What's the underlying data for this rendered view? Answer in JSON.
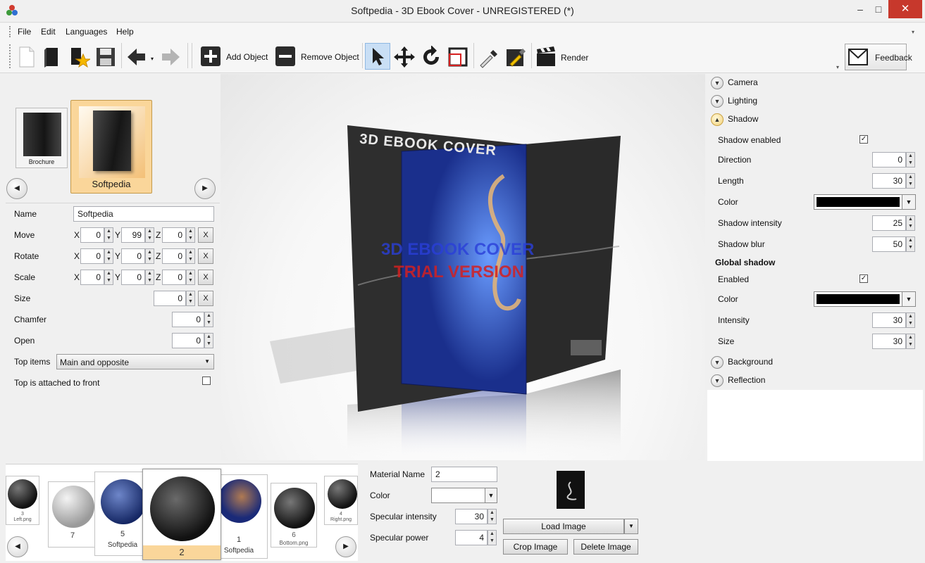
{
  "window": {
    "title": "Softpedia - 3D Ebook Cover - UNREGISTERED (*)",
    "minimize": "–",
    "maximize": "□",
    "close": "✕"
  },
  "menu": [
    "File",
    "Edit",
    "Languages",
    "Help"
  ],
  "toolbar": {
    "add_object": "Add Object",
    "remove_object": "Remove Object",
    "render": "Render",
    "feedback": "Feedback",
    "icons": [
      "new-page-icon",
      "book-icon",
      "favorite-star-icon",
      "save-icon",
      "back-arrow-icon",
      "forward-arrow-icon",
      "add-icon",
      "remove-icon",
      "select-pointer-icon",
      "move-arrows-icon",
      "rotate-icon",
      "crop-frame-icon",
      "eyedropper-icon",
      "color-picker-icon",
      "clapperboard-icon",
      "envelope-icon"
    ]
  },
  "templates": {
    "items": [
      {
        "label": "Brochure"
      },
      {
        "label": "Softpedia",
        "selected": true
      }
    ],
    "prev": "◀",
    "next": "▶"
  },
  "props": {
    "name_label": "Name",
    "name_value": "Softpedia",
    "move_label": "Move",
    "move": {
      "x": "0",
      "y": "99",
      "z": "0"
    },
    "rotate_label": "Rotate",
    "rotate": {
      "x": "0",
      "y": "0",
      "z": "0"
    },
    "scale_label": "Scale",
    "scale": {
      "x": "0",
      "y": "0",
      "z": "0"
    },
    "axis_x": "X",
    "axis_y": "Y",
    "axis_z": "Z",
    "reset": "X",
    "size_label": "Size",
    "size_value": "0",
    "chamfer_label": "Chamfer",
    "chamfer_value": "0",
    "open_label": "Open",
    "open_value": "0",
    "top_items_label": "Top items",
    "top_items_value": "Main and opposite",
    "top_attached_label": "Top is attached to front",
    "top_attached_checked": false
  },
  "viewport": {
    "cover_title": "3D EBOOK COVER",
    "watermark_line1": "3D EBOOK COVER",
    "watermark_line2": "TRIAL VERSION",
    "colors": {
      "cover_blue": "#1a2f8c",
      "back_panel": "#2e2e2e",
      "watermark_blue": "#2a3fd9",
      "watermark_red": "#d42020"
    }
  },
  "right": {
    "sections": {
      "camera": "Camera",
      "lighting": "Lighting",
      "shadow": "Shadow",
      "background": "Background",
      "reflection": "Reflection"
    },
    "shadow": {
      "enabled_label": "Shadow enabled",
      "enabled": true,
      "direction_label": "Direction",
      "direction": "0",
      "length_label": "Length",
      "length": "30",
      "color_label": "Color",
      "color": "#000000",
      "intensity_label": "Shadow intensity",
      "intensity": "25",
      "blur_label": "Shadow blur",
      "blur": "50"
    },
    "global": {
      "title": "Global shadow",
      "enabled_label": "Enabled",
      "enabled": true,
      "color_label": "Color",
      "color": "#000000",
      "intensity_label": "Intensity",
      "intensity": "30",
      "size_label": "Size",
      "size": "30"
    }
  },
  "materials": {
    "items": [
      {
        "num": "3",
        "file": "Left.png"
      },
      {
        "num": "7",
        "file": ""
      },
      {
        "num": "5",
        "file": "Softpedia"
      },
      {
        "num": "2",
        "file": "",
        "selected": true
      },
      {
        "num": "1",
        "file": "Softpedia"
      },
      {
        "num": "6",
        "file": "Bottom.png"
      },
      {
        "num": "4",
        "file": "Right.png"
      }
    ]
  },
  "material": {
    "name_label": "Material Name",
    "name_value": "2",
    "color_label": "Color",
    "spec_int_label": "Specular intensity",
    "spec_int": "30",
    "spec_pow_label": "Specular power",
    "spec_pow": "4",
    "load_image": "Load Image",
    "crop_image": "Crop Image",
    "delete_image": "Delete Image"
  }
}
